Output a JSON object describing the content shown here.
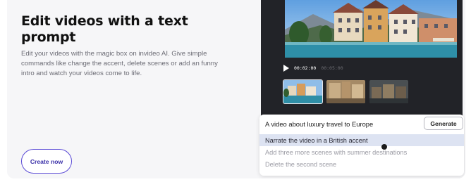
{
  "feature": {
    "title": "Edit videos with a text prompt",
    "description": "Edit your videos with the magic box on invideo AI. Give simple commands like change the accent, delete scenes or add an funny intro and watch your videos come to life.",
    "cta_label": "Create now"
  },
  "player": {
    "current_time": "00:02:00",
    "total_time": "00:05:00"
  },
  "prompt": {
    "text": "A video about luxury travel to Europe",
    "button_label": "Generate",
    "suggestions": [
      "Narrate the video in a British accent",
      "Add three more scenes with summer destinations",
      "Delete the second scene"
    ]
  },
  "colors": {
    "accent": "#5b4bd6",
    "player_bg": "#222328",
    "highlight": "#dde3f2"
  }
}
